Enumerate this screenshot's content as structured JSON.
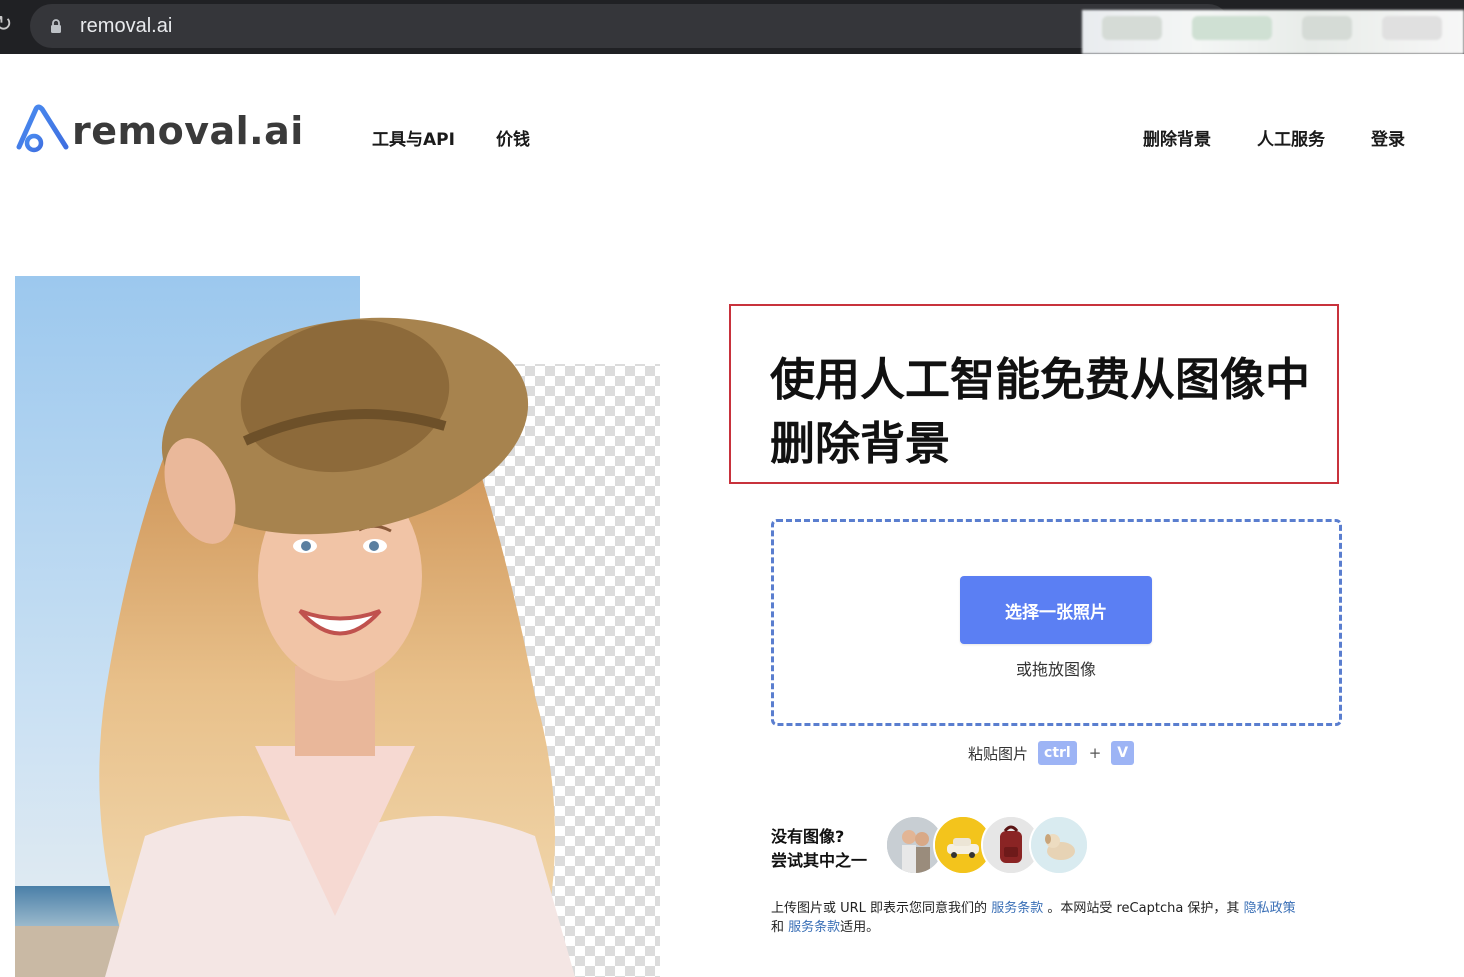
{
  "browser": {
    "url": "removal.ai"
  },
  "header": {
    "brand": "removal.ai",
    "nav_left": [
      "工具与API",
      "价钱"
    ],
    "nav_right": [
      "删除背景",
      "人工服务",
      "登录"
    ]
  },
  "hero": {
    "headline_line1": "使用人工智能免费从图像中",
    "headline_line2": "删除背景"
  },
  "upload": {
    "button_label": "选择一张照片",
    "drag_text": "或拖放图像",
    "paste_label": "粘贴图片",
    "key_ctrl": "ctrl",
    "key_plus": "+",
    "key_v": "V"
  },
  "samples": {
    "prompt_line1": "没有图像?",
    "prompt_line2": "尝试其中之一",
    "items": [
      "couple-photo",
      "car-photo",
      "backpack-photo",
      "dog-photo"
    ]
  },
  "legal": {
    "text1": "上传图片或 URL 即表示您同意我们的",
    "link_terms": "服务条款",
    "text2": "。本网站受 reCaptcha 保护，其",
    "link_privacy": "隐私政策",
    "text3": "和",
    "link_terms2": "服务条款",
    "text4": "适用。"
  },
  "colors": {
    "accent": "#5b7ff3",
    "highlight_border": "#c8323c",
    "dropzone_border": "#5a7ecf",
    "link": "#3a6fb6"
  }
}
